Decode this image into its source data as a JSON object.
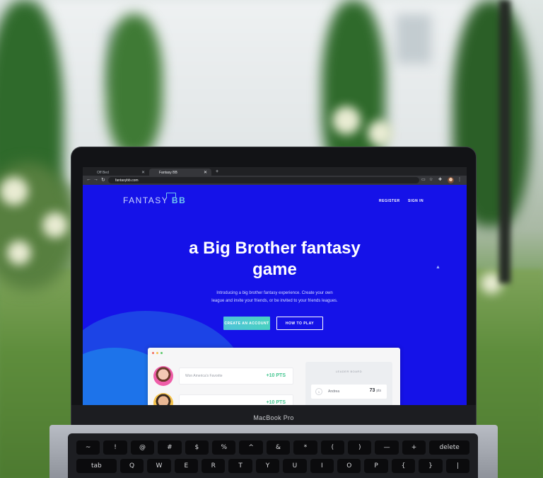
{
  "browser": {
    "tabs": [
      {
        "label": "Off Bed"
      },
      {
        "label": "Fantasy BB"
      }
    ],
    "url": "fantasybb.com"
  },
  "site": {
    "logo": {
      "text_a": "FANTASY",
      "text_b": "BB"
    },
    "nav": {
      "register": "REGISTER",
      "sign_in": "SIGN IN"
    },
    "hero_line1": "a Big Brother fantasy",
    "hero_line2": "game",
    "subtitle_line1": "Introducing a big brother fantasy experience. Create your own",
    "subtitle_line2": "league and invite your friends, or be invited to your friends leagues.",
    "create_account_label": "CREATE AN ACCOUNT",
    "how_to_play_label": "HOW TO PLAY",
    "preview": {
      "row_label": "Won America's Favorite",
      "row_points": "+10 PTS",
      "row2_points": "+10 PTS",
      "leaderboard_title": "LEADER BOARD",
      "leader": {
        "rank": "1",
        "name": "Andrea",
        "points": "73",
        "unit": "pts"
      }
    }
  },
  "laptop": {
    "label": "MacBook Pro"
  },
  "keyboard": {
    "row1": [
      "~",
      "!",
      "@",
      "#",
      "$",
      "%",
      "^",
      "&",
      "*",
      "(",
      ")",
      "—",
      "+",
      "delete"
    ],
    "row2": [
      "tab",
      "Q",
      "W",
      "E",
      "R",
      "T",
      "Y",
      "U",
      "I",
      "O",
      "P",
      "{",
      "}",
      "|"
    ]
  },
  "colors": {
    "site_bg": "#1512e8",
    "accent_teal": "#49d1c0",
    "points_green": "#42c58f"
  }
}
